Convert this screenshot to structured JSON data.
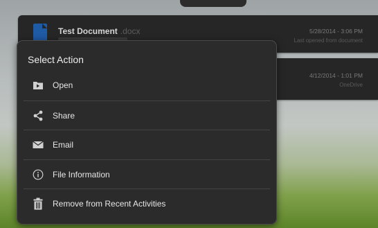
{
  "background_cards": [
    {
      "title": "Test Document",
      "extension": ".docx",
      "date": "5/28/2014 - 3:06 PM",
      "sub": "Last opened from document"
    },
    {
      "title": "",
      "extension": "",
      "date": "4/12/2014 - 1:01 PM",
      "sub": "OneDrive"
    }
  ],
  "dialog": {
    "title": "Select Action",
    "actions": [
      {
        "label": "Open",
        "icon": "open-icon"
      },
      {
        "label": "Share",
        "icon": "share-icon"
      },
      {
        "label": "Email",
        "icon": "email-icon"
      },
      {
        "label": "File Information",
        "icon": "info-icon"
      },
      {
        "label": "Remove from Recent Activities",
        "icon": "trash-icon"
      }
    ]
  },
  "colors": {
    "dialog_bg": "#2b2b2b",
    "divider": "#444444",
    "icon": "#d0d0d0",
    "text": "#e6e6e6"
  }
}
